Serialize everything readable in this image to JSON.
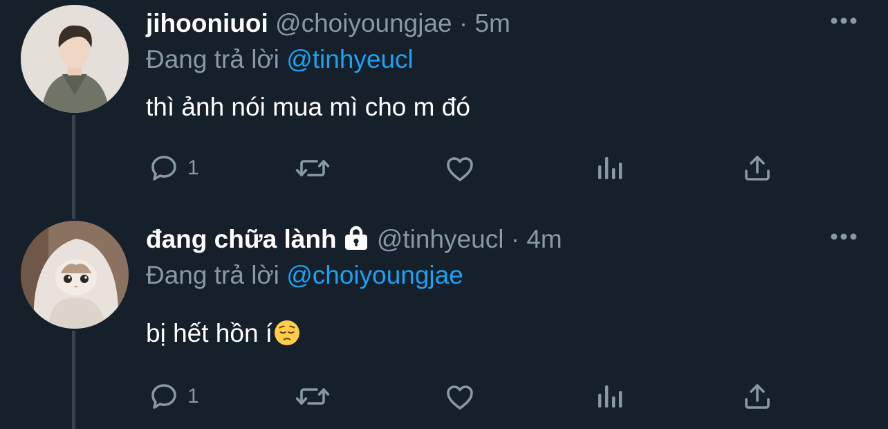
{
  "tweets": [
    {
      "display_name": "jihooniuoi",
      "handle": "@choiyoungjae",
      "separator": "·",
      "time": "5m",
      "replying_prefix": "Đang trả lời",
      "replying_to": "@tinhyeucl",
      "text": "thì ảnh nói mua mì cho m đó",
      "reply_count": "1",
      "avatar": "person-photo",
      "protected": false
    },
    {
      "display_name": "đang chữa lành",
      "handle": "@tinhyeucl",
      "separator": "·",
      "time": "4m",
      "replying_prefix": "Đang trả lời",
      "replying_to": "@choiyoungjae",
      "text": "bị hết hồn í",
      "text_emoji": "pensive-face-emoji",
      "reply_count": "1",
      "avatar": "cat-in-blanket-photo",
      "protected": true
    }
  ],
  "icons": {
    "reply": "reply-icon",
    "retweet": "retweet-icon",
    "like": "like-icon",
    "analytics": "analytics-icon",
    "share": "share-icon",
    "more": "more-icon",
    "lock": "lock-icon"
  },
  "colors": {
    "background": "#15202b",
    "text_primary": "#ffffff",
    "text_secondary": "#8899a6",
    "accent": "#1da1f2",
    "thread_line": "#38444d"
  }
}
